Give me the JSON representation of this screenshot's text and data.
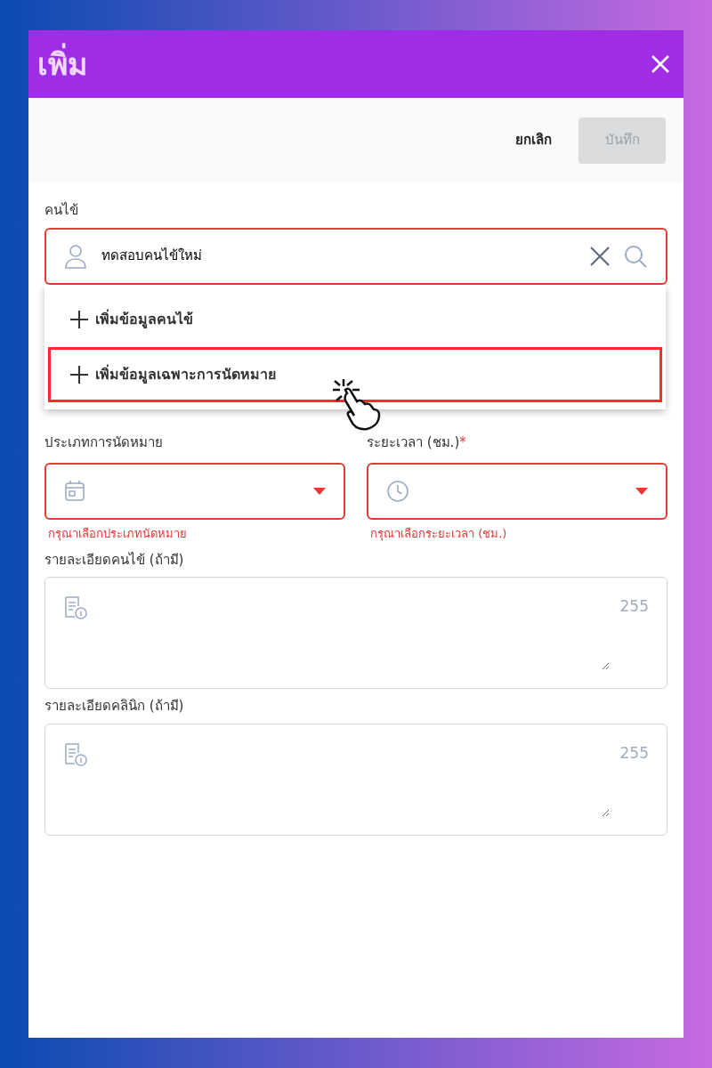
{
  "dialog": {
    "title": "เพิ่ม"
  },
  "toolbar": {
    "cancel": "ยกเลิก",
    "save": {
      "label": "บันทึก",
      "disabled": true
    }
  },
  "patient": {
    "label": "คนไข้",
    "value": "ทดสอบคนไข้ใหม่",
    "invalid": true
  },
  "menu": [
    {
      "label": "เพิ่มข้อมูลคนไข้",
      "selected": false
    },
    {
      "label": "เพิ่มข้อมูลเฉพาะการนัดหมาย",
      "selected": true
    }
  ],
  "selects": [
    {
      "kind": "calendar",
      "label": "ประเภทการนัดหมาย",
      "invalid": true,
      "error": "กรุณาเลือกประเภทนัดหมาย"
    },
    {
      "kind": "clock",
      "label": "ระยะเวลา (ชม.)",
      "required_mark": "*",
      "invalid": true,
      "error": "กรุณาเลือกระยะเวลา (ชม.)"
    }
  ],
  "notes": [
    {
      "label": "รายละเอียดคนไข้ (ถ้ามี)",
      "counter": "255"
    },
    {
      "label": "รายละเอียดคลินิก (ถ้ามี)",
      "counter": "255"
    }
  ]
}
